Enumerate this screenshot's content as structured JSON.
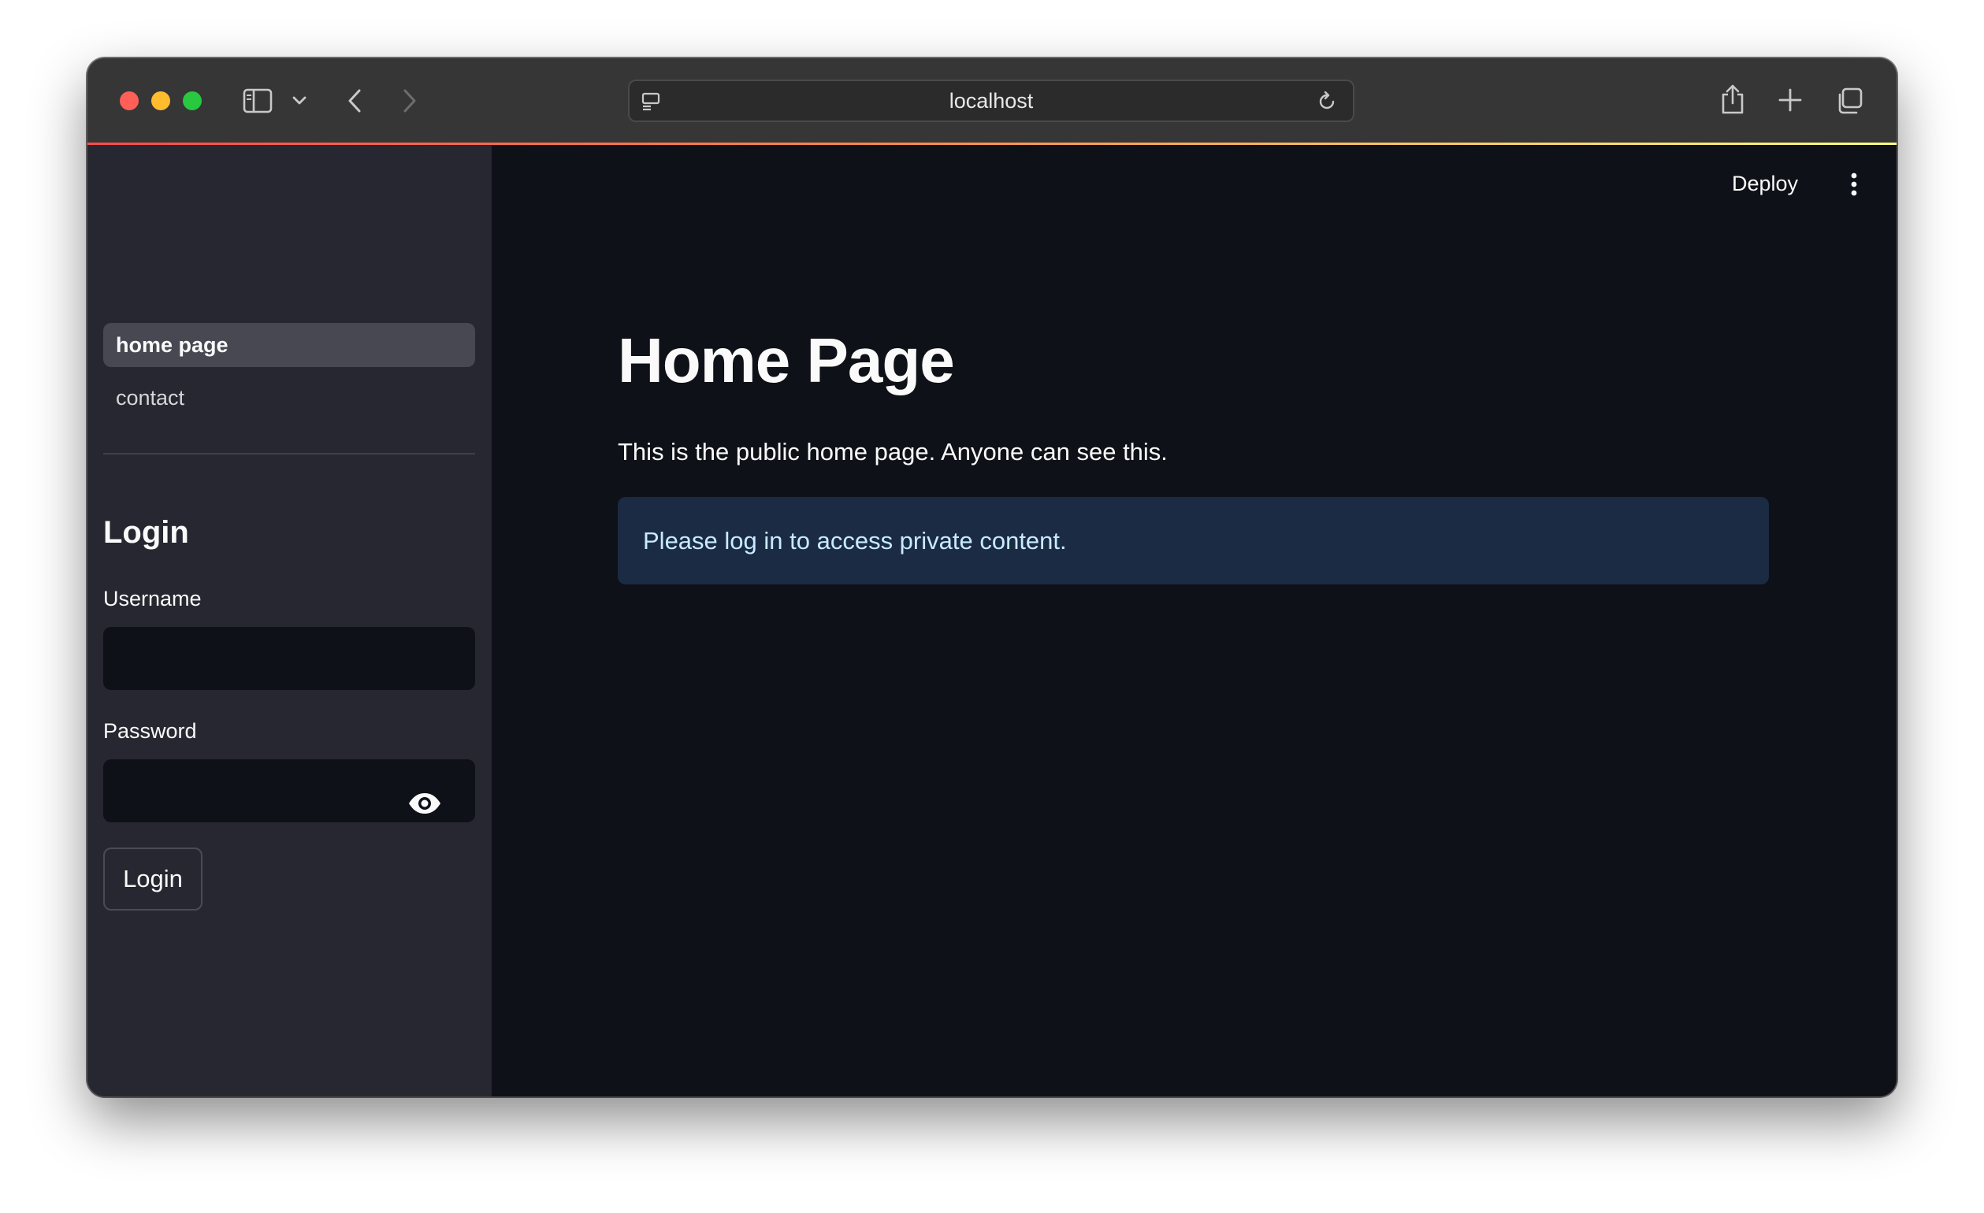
{
  "browser": {
    "url": "localhost"
  },
  "sidebar": {
    "nav": [
      {
        "label": "home page",
        "active": true
      },
      {
        "label": "contact",
        "active": false
      }
    ],
    "login": {
      "heading": "Login",
      "username_label": "Username",
      "username_value": "",
      "password_label": "Password",
      "password_value": "",
      "submit_label": "Login"
    }
  },
  "header": {
    "deploy_label": "Deploy"
  },
  "main": {
    "title": "Home Page",
    "text": "This is the public home page. Anyone can see this.",
    "info": "Please log in to access private content."
  },
  "colors": {
    "accent_red": "#ff4b4b",
    "info_bg": "#1c2b44",
    "sidebar_bg": "#262730",
    "main_bg": "#0e1117"
  }
}
